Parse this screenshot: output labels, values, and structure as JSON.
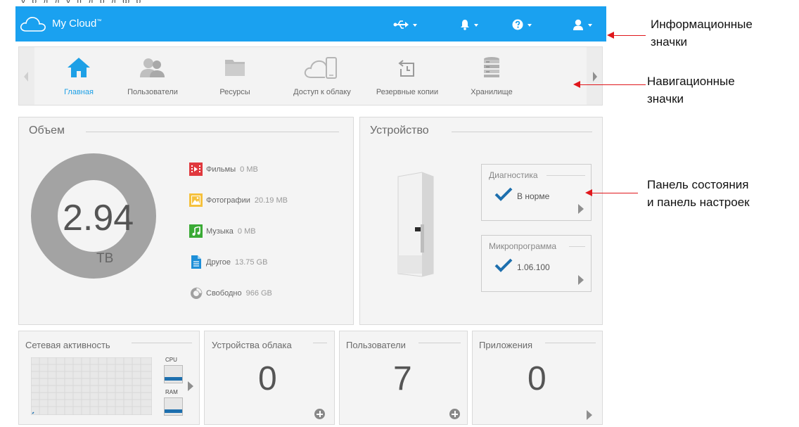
{
  "header": {
    "app_name": "My Cloud",
    "trademark": "™",
    "icons": [
      "usb-icon",
      "bell-icon",
      "help-icon",
      "user-icon"
    ]
  },
  "nav": {
    "items": [
      {
        "label": "Главная",
        "icon": "home-icon",
        "active": true
      },
      {
        "label": "Пользователи",
        "icon": "users-icon",
        "active": false
      },
      {
        "label": "Ресурсы",
        "icon": "folder-icon",
        "active": false
      },
      {
        "label": "Доступ к облаку",
        "icon": "cloud-access-icon",
        "active": false
      },
      {
        "label": "Резервные копии",
        "icon": "backup-icon",
        "active": false
      },
      {
        "label": "Хранилище",
        "icon": "storage-icon",
        "active": false
      }
    ]
  },
  "capacity": {
    "title": "Объем",
    "total_value": "2.94",
    "total_unit": "TB",
    "items": [
      {
        "label": "Фильмы",
        "value": "0 MB",
        "color": "#e0393e",
        "icon": "film-icon"
      },
      {
        "label": "Фотографии",
        "value": "20.19 MB",
        "color": "#f5c13d",
        "icon": "photo-icon"
      },
      {
        "label": "Музыка",
        "value": "0 MB",
        "color": "#3aaa35",
        "icon": "music-icon"
      },
      {
        "label": "Другое",
        "value": "13.75 GB",
        "color": "#1e8fd8",
        "icon": "document-icon"
      },
      {
        "label": "Свободно",
        "value": "966 GB",
        "color": "#a0a0a0",
        "icon": "free-space-icon"
      }
    ]
  },
  "device": {
    "title": "Устройство",
    "diagnostics": {
      "title": "Диагностика",
      "value": "В норме"
    },
    "firmware": {
      "title": "Микропрограмма",
      "value": "1.06.100"
    }
  },
  "network": {
    "title": "Сетевая активность",
    "cpu_label": "CPU",
    "ram_label": "RAM"
  },
  "cloud_devices": {
    "title": "Устройства облака",
    "count": "0"
  },
  "users": {
    "title": "Пользователи",
    "count": "7"
  },
  "apps": {
    "title": "Приложения",
    "count": "0"
  },
  "annotations": {
    "info": [
      "Информационные",
      "значки"
    ],
    "nav": [
      "Навигационные",
      "значки"
    ],
    "status": [
      "Панель состояния",
      "и панель настроек"
    ]
  },
  "colors": {
    "header": "#1aa1f0",
    "active": "#1ea0e6",
    "check": "#1d6fae",
    "arrow": "#e0171c"
  }
}
